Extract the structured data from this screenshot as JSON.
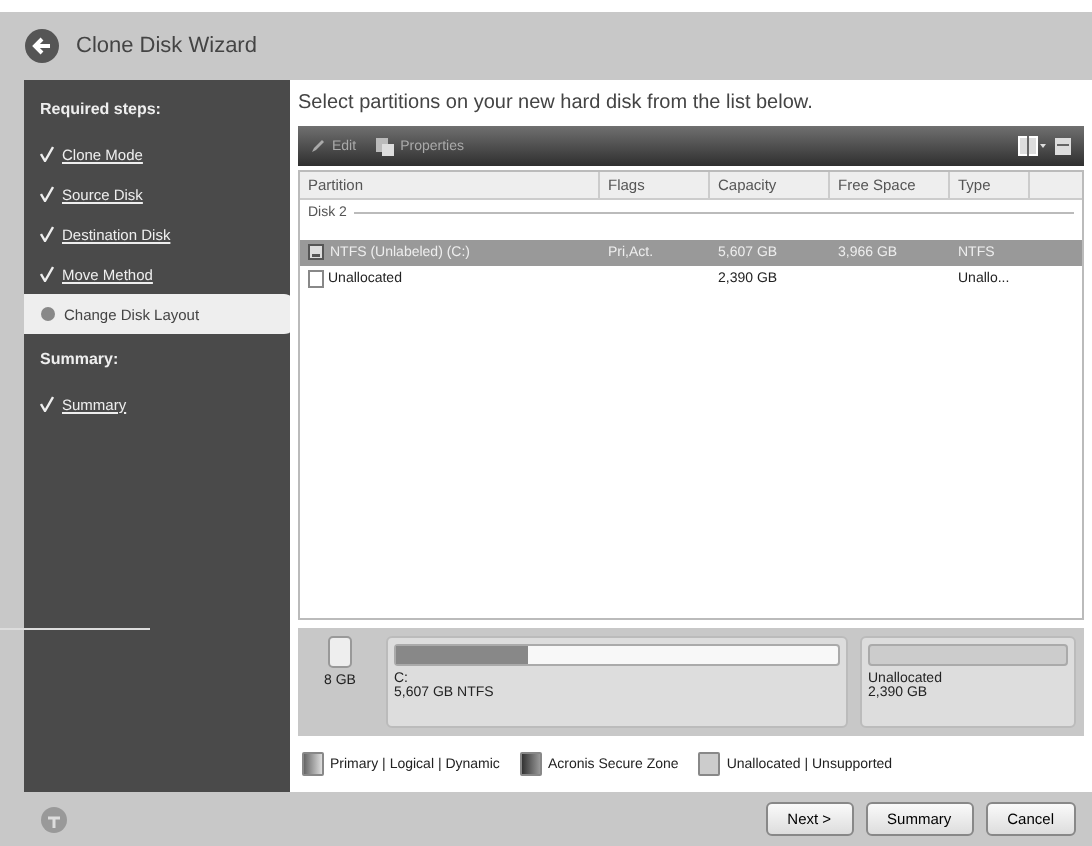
{
  "window": {
    "title": "Clone Disk Wizard"
  },
  "sidebar": {
    "sections": [
      {
        "heading": "Required steps:",
        "items": [
          {
            "label": "Clone Mode",
            "done": true,
            "selected": false
          },
          {
            "label": "Source Disk",
            "done": true,
            "selected": false
          },
          {
            "label": "Destination Disk",
            "done": true,
            "selected": false
          },
          {
            "label": "Move Method",
            "done": true,
            "selected": false
          },
          {
            "label": "Change Disk Layout",
            "done": false,
            "selected": true
          }
        ]
      },
      {
        "heading": "Summary:",
        "items": [
          {
            "label": "Summary",
            "done": true,
            "selected": false
          }
        ]
      }
    ]
  },
  "instruction": "Select partitions on your new hard disk from the list below.",
  "toolbar": {
    "items": [
      {
        "label": "Edit",
        "kind": "edit"
      },
      {
        "label": "Properties",
        "kind": "properties"
      }
    ]
  },
  "table": {
    "columns": [
      "Partition",
      "Flags",
      "Capacity",
      "Free Space",
      "Type"
    ],
    "group": "Disk 2",
    "rows": [
      {
        "partition": "NTFS (Unlabeled) (C:)",
        "flags": "Pri,Act.",
        "capacity": "5,607 GB",
        "free_space": "3,966 GB",
        "type": "NTFS",
        "selected": true
      },
      {
        "partition": "Unallocated",
        "capacity": "2,390 GB",
        "type": "Unallo...",
        "selected": false
      }
    ]
  },
  "disk_map": {
    "size": "8 GB",
    "partitions": [
      {
        "name": "C:",
        "detail": "5,607 GB NTFS",
        "kind": "primary",
        "level": 0.3
      },
      {
        "name": "Unallocated",
        "detail": "2,390 GB",
        "kind": "unallocated"
      }
    ]
  },
  "legend": [
    {
      "label": "Primary | Logical | Dynamic",
      "kind": "primary"
    },
    {
      "label": "Acronis Secure Zone",
      "kind": "secure"
    },
    {
      "label": "Unallocated | Unsupported",
      "kind": "unallocated"
    }
  ],
  "buttons": [
    "Next >",
    "Summary",
    "Cancel"
  ]
}
